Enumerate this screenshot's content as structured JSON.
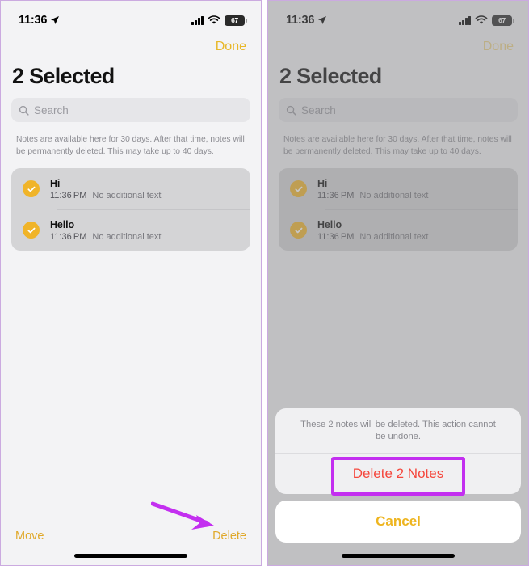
{
  "status_bar": {
    "time": "11:36",
    "location_icon": "location-arrow-icon",
    "cellular_icon": "cellular-bars-icon",
    "wifi_icon": "wifi-icon",
    "battery_percent": "67"
  },
  "screen": {
    "done_label": "Done",
    "title": "2 Selected",
    "search_placeholder": "Search",
    "info_text": "Notes are available here for 30 days. After that time, notes will be permanently deleted. This may take up to 40 days."
  },
  "notes": [
    {
      "title": "Hi",
      "time": "11:36 PM",
      "preview": "No additional text",
      "selected": true
    },
    {
      "title": "Hello",
      "time": "11:36 PM",
      "preview": "No additional text",
      "selected": true
    }
  ],
  "toolbar": {
    "move_label": "Move",
    "delete_label": "Delete"
  },
  "action_sheet": {
    "message": "These 2 notes will be deleted. This action cannot be undone.",
    "destructive_label": "Delete 2 Notes",
    "cancel_label": "Cancel"
  },
  "annotations": {
    "arrow_color": "#c32ff0",
    "highlight_color": "#c32ff0"
  },
  "colors": {
    "accent_yellow": "#e8b82a",
    "destructive_red": "#f5473d",
    "checkmark_fill": "#f0b429",
    "screen_bg": "#f3f3f5",
    "card_bg": "#d4d4d6"
  }
}
